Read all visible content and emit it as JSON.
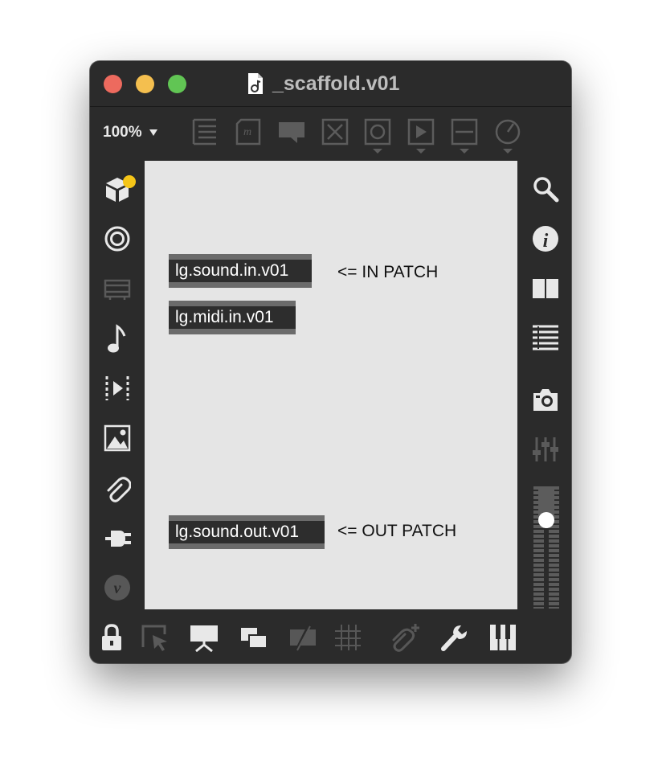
{
  "window": {
    "title": "_scaffold.v01",
    "icons": [
      "file-music-icon"
    ]
  },
  "toolbar": {
    "zoom_label": "100%",
    "items": [
      "presentation-mode-icon",
      "message-box-icon",
      "comment-icon",
      "toggle-x-icon",
      "button-icon",
      "play-toggle-icon",
      "slider-icon",
      "dial-icon"
    ]
  },
  "left_palette": {
    "items": [
      "new-objects-icon",
      "audio-icon",
      "video-icon",
      "music-note-icon",
      "media-timeline-icon",
      "image-icon",
      "attachment-icon",
      "plugin-icon",
      "vimeo-icon"
    ]
  },
  "right_palette": {
    "items": [
      "search-icon",
      "info-icon",
      "book-icon",
      "list-icon",
      "camera-icon",
      "mixer-icon",
      "level-meter"
    ]
  },
  "bottom_toolbar": {
    "items": [
      "lock-icon",
      "select-icon",
      "presentation-icon",
      "layers-icon",
      "hide-icon",
      "grid-icon",
      "add-attachment-icon",
      "wrench-icon",
      "piano-icon"
    ]
  },
  "canvas": {
    "objects": [
      {
        "label": "lg.sound.in.v01"
      },
      {
        "label": "lg.midi.in.v01"
      },
      {
        "label": "lg.sound.out.v01"
      }
    ],
    "comments": [
      {
        "text": "<= IN PATCH"
      },
      {
        "text": "<= OUT PATCH"
      }
    ]
  },
  "colors": {
    "window_bg": "#2b2b2b",
    "canvas_bg": "#e5e5e5",
    "object_bg": "#2d2d2d",
    "object_border": "#6b6b6b",
    "accent_yellow": "#f5c518"
  }
}
